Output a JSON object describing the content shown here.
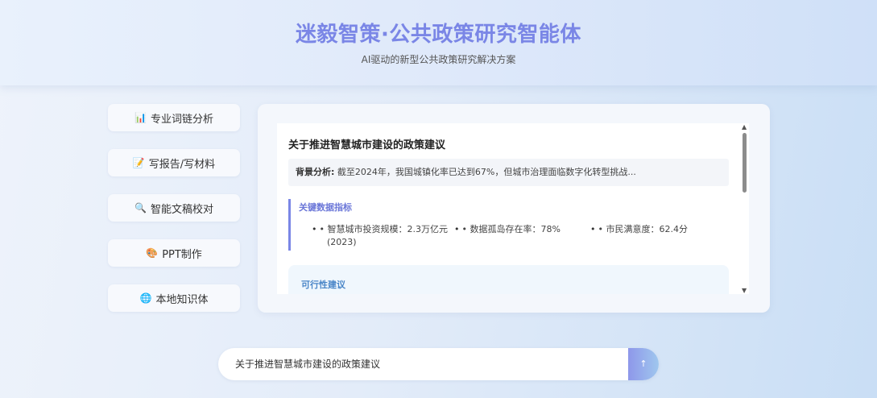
{
  "header": {
    "title": "迷毅智策·公共政策研究智能体",
    "subtitle": "AI驱动的新型公共政策研究解决方案"
  },
  "sidebar": {
    "items": [
      {
        "icon": "bar-chart-icon",
        "glyph": "📊",
        "label": "专业词链分析"
      },
      {
        "icon": "memo-icon",
        "glyph": "📝",
        "label": "写报告/写材料"
      },
      {
        "icon": "magnifier-icon",
        "glyph": "🔍",
        "label": "智能文稿校对"
      },
      {
        "icon": "palette-icon",
        "glyph": "🎨",
        "label": "PPT制作"
      },
      {
        "icon": "globe-icon",
        "glyph": "🌐",
        "label": "本地知识体"
      }
    ]
  },
  "document": {
    "title": "关于推进智慧城市建设的政策建议",
    "background_label": "背景分析:",
    "background_text": "截至2024年，我国城镇化率已达到67%，但城市治理面临数字化转型挑战...",
    "metrics_title": "关键数据指标",
    "metrics": [
      "• 智慧城市投资规模：2.3万亿元",
      "(2023)",
      "• 数据孤岛存在率：78%",
      "• 市民满意度：62.4分"
    ],
    "bullet": "•",
    "suggestion_title": "可行性建议"
  },
  "chat": {
    "input_value": "关于推进智慧城市建设的政策建议",
    "send_label": "↑"
  },
  "colors": {
    "accent": "#7a86e6",
    "suggest_title": "#4a86c8"
  }
}
